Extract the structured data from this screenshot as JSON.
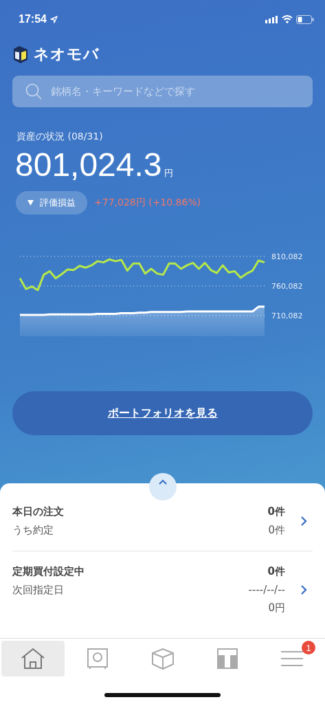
{
  "status_bar": {
    "time": "17:54"
  },
  "header": {
    "app_name": "ネオモバ"
  },
  "search": {
    "placeholder": "銘柄名・キーワードなどで探す"
  },
  "assets": {
    "label": "資産の状況 (08/31)",
    "amount": "801,024.3",
    "unit": "円",
    "toggle": "評価損益",
    "change": "+77,028円 (+10.86%)",
    "chart_data": {
      "type": "line",
      "grid": true,
      "ylim": [
        710082,
        810082
      ],
      "yticks": [
        {
          "value": 710082,
          "label": "710,082"
        },
        {
          "value": 760082,
          "label": "760,082"
        },
        {
          "value": 810082,
          "label": "810,082"
        }
      ],
      "series": [
        {
          "color": "#b5e84a",
          "values": [
            773000,
            755000,
            759000,
            753000,
            779000,
            785000,
            773000,
            780000,
            788000,
            787000,
            794000,
            791000,
            795000,
            802000,
            800000,
            805000,
            802000,
            804000,
            786000,
            798000,
            798000,
            781000,
            789000,
            781000,
            779000,
            798000,
            798000,
            789000,
            795000,
            799000,
            789000,
            799000,
            787000,
            782000,
            795000,
            783000,
            785000,
            774000,
            781000,
            786000,
            803000,
            800000
          ]
        },
        {
          "color": "#ffffff",
          "values": [
            711000,
            711000,
            711000,
            711000,
            711000,
            712000,
            712000,
            712000,
            712000,
            712000,
            712000,
            712000,
            712000,
            713000,
            713000,
            713000,
            713000,
            714000,
            714000,
            714000,
            715000,
            715000,
            716000,
            716000,
            716000,
            716000,
            716000,
            716000,
            717000,
            717000,
            717000,
            717000,
            717000,
            717000,
            717000,
            717000,
            717000,
            717000,
            717000,
            717000,
            725000,
            725000
          ]
        }
      ]
    }
  },
  "portfolio_button": "ポートフォリオを見る",
  "orders": [
    {
      "title": "本日の注文",
      "title_value": "0件",
      "lines": [
        {
          "label": "うち約定",
          "value": "0件"
        }
      ]
    },
    {
      "title": "定期買付設定中",
      "title_value": "0件",
      "lines": [
        {
          "label": "次回指定日",
          "value": "----/--/--"
        },
        {
          "value": "0円"
        }
      ]
    }
  ],
  "tab_bar": [
    {
      "kind": "home",
      "selected": true
    },
    {
      "kind": "safe",
      "selected": false
    },
    {
      "kind": "box",
      "selected": false
    },
    {
      "kind": "store",
      "selected": false
    },
    {
      "kind": "menu",
      "selected": false,
      "badge": "1"
    }
  ]
}
